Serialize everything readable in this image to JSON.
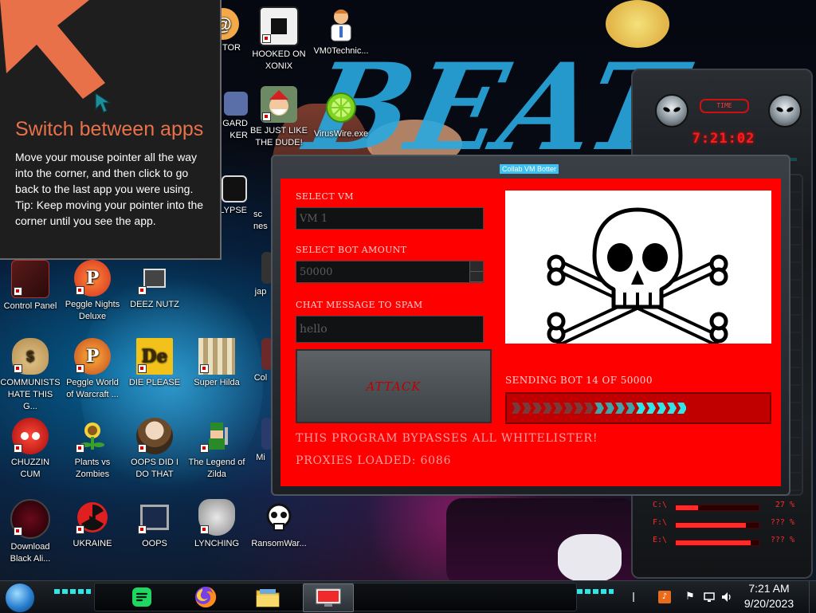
{
  "charm_tip": {
    "title": "Switch between apps",
    "line1": "Move your mouse pointer all the way into the corner, and then click to go back to the last app you were using.",
    "line2": "Tip: Keep moving your pointer into the corner until you see the app."
  },
  "wallpaper": {
    "logo_text": "BEAT"
  },
  "desktop_icons": [
    {
      "label": "TOR",
      "icon": "tor-icon"
    },
    {
      "label": "HOOKED ON XONIX",
      "icon": "xonix-icon"
    },
    {
      "label": "VM0Technic...",
      "icon": "doctor-icon"
    },
    {
      "label": "GARD KER",
      "icon": "app-icon"
    },
    {
      "label": "BE JUST LIKE THE DUDE!",
      "icon": "santa-icon"
    },
    {
      "label": "VirusWire.exe",
      "icon": "lime-icon"
    },
    {
      "label": "LYPSE",
      "icon": "app-icon"
    },
    {
      "label": "sc nes",
      "icon": "app-icon"
    },
    {
      "label": "Control Panel",
      "icon": "control-panel-icon"
    },
    {
      "label": "Peggle Nights Deluxe",
      "icon": "peggle-icon"
    },
    {
      "label": "DEEZ NUTZ",
      "icon": "windows-icon"
    },
    {
      "label": "jap",
      "icon": "app-icon"
    },
    {
      "label": "COMMUNISTS HATE THIS G...",
      "icon": "moneybag-icon"
    },
    {
      "label": "Peggle World of Warcraft ...",
      "icon": "peggle-icon"
    },
    {
      "label": "DIE PLEASE",
      "icon": "de-icon"
    },
    {
      "label": "Super Hilda",
      "icon": "pixel-icon"
    },
    {
      "label": "Col",
      "icon": "app-icon"
    },
    {
      "label": "CHUZZIN CUM",
      "icon": "chuzzle-icon"
    },
    {
      "label": "Plants vs Zombies",
      "icon": "plant-icon"
    },
    {
      "label": "OOPS DID I DO THAT",
      "icon": "portrait-icon"
    },
    {
      "label": "The Legend of Zilda",
      "icon": "zelda-icon"
    },
    {
      "label": "Mi",
      "icon": "app-icon"
    },
    {
      "label": "Download Black Ali...",
      "icon": "alien-icon"
    },
    {
      "label": "UKRAINE",
      "icon": "radiation-icon"
    },
    {
      "label": "OOPS",
      "icon": "monitor-icon"
    },
    {
      "label": "LYNCHING",
      "icon": "dragon-icon"
    },
    {
      "label": "RansomWar...",
      "icon": "skull-icon"
    }
  ],
  "gadget": {
    "title": "TIME",
    "time": "7:21:02",
    "stats": [
      {
        "label": "C:\\",
        "value": "27 %",
        "fill": 0.27
      },
      {
        "label": "F:\\",
        "value": "??? %",
        "fill": 0.85
      },
      {
        "label": "E:\\",
        "value": "??? %",
        "fill": 0.9
      }
    ]
  },
  "botter": {
    "window_title": "Collab VM Botter",
    "select_vm_label": "SELECT VM",
    "select_vm_value": "VM 1",
    "bot_amount_label": "SELECT BOT AMOUNT",
    "bot_amount_value": "50000",
    "chat_label": "CHAT MESSAGE TO SPAM",
    "chat_value": "hello",
    "attack_label": "ATTACK",
    "status_text": "SENDING BOT 14 OF 50000",
    "progress": 0.68,
    "bypass_text": "THIS PROGRAM BYPASSES ALL WHITELISTER!",
    "proxies_text": "PROXIES LOADED: 6086",
    "image": "skull-and-crossbones-icon"
  },
  "taskbar": {
    "apps": [
      {
        "name": "spotify",
        "icon": "spotify-icon"
      },
      {
        "name": "firefox",
        "icon": "firefox-icon"
      },
      {
        "name": "file-explorer",
        "icon": "folder-icon"
      },
      {
        "name": "collab-vm-botter",
        "icon": "botter-icon"
      }
    ],
    "tray": [
      "flag-icon",
      "network-icon",
      "volume-icon"
    ],
    "time": "7:21 AM",
    "date": "9/20/2023"
  },
  "colors": {
    "accent": "#ff0000",
    "charm_title": "#e8714a",
    "wallpaper_text": "#29a9e0",
    "progress_cyan": "#2ee6e6"
  }
}
